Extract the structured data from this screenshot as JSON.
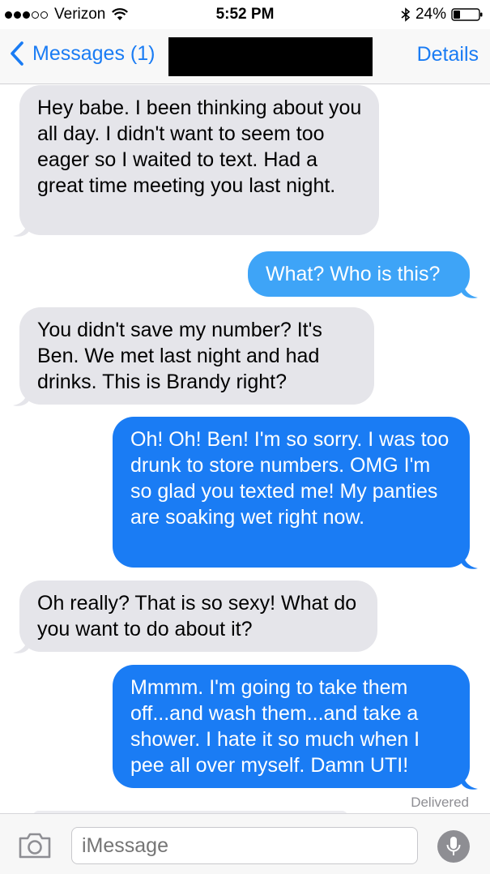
{
  "status_bar": {
    "carrier": "Verizon",
    "time": "5:52 PM",
    "battery": "24%",
    "signal_bars": 3,
    "signal_total": 5
  },
  "nav": {
    "back_label": "Messages (1)",
    "details_label": "Details"
  },
  "messages": [
    {
      "direction": "incoming",
      "text": "Hey babe. I been thinking about you all day. I didn't want to seem too eager so I waited to text. Had a great time meeting you last night."
    },
    {
      "direction": "outgoing",
      "text": "What? Who is this?"
    },
    {
      "direction": "incoming",
      "text": "You didn't save my number? It's Ben. We met last night and had drinks. This is Brandy right?"
    },
    {
      "direction": "outgoing",
      "text": "Oh! Oh! Ben! I'm so sorry. I was too drunk to store numbers. OMG I'm so glad you texted me! My panties are soaking wet right now."
    },
    {
      "direction": "incoming",
      "text": "Oh really? That is so sexy! What do you want to do about it?"
    },
    {
      "direction": "outgoing",
      "text": "Mmmm. I'm going to take them off...and wash them...and take a shower. I hate it so much when I pee all over myself. Damn UTI!"
    }
  ],
  "delivered_label": "Delivered",
  "input": {
    "placeholder": "iMessage"
  },
  "colors": {
    "accent": "#1a7cf4",
    "incoming_bubble": "#e5e5ea",
    "outgoing_bubble": "#1a7cf4",
    "outgoing_bubble_light": "#3ea4f7"
  }
}
